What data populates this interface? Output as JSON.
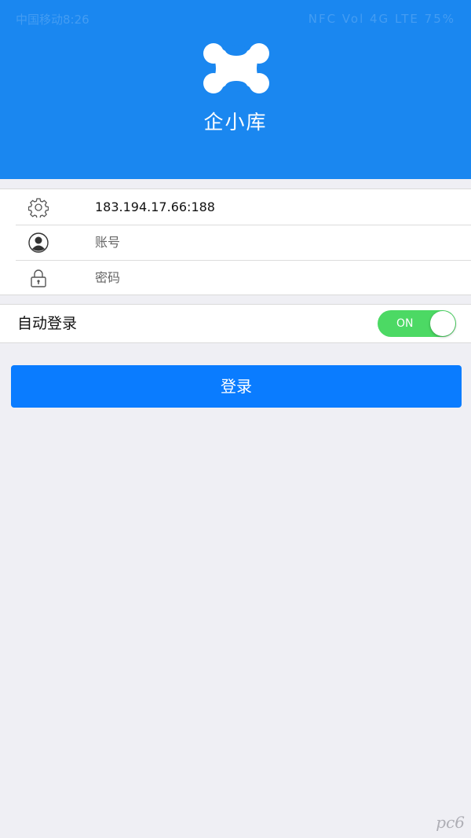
{
  "status_bar": {
    "carrier_time": "中国移动8:26",
    "indicators": "NFC Vol 4G LTE 75%"
  },
  "app": {
    "title": "企小库",
    "logo_icon": "x-logo-icon"
  },
  "form": {
    "server": {
      "icon": "gear-icon",
      "value": "183.194.17.66:188"
    },
    "account": {
      "icon": "user-icon",
      "placeholder": "账号"
    },
    "password": {
      "icon": "lock-icon",
      "placeholder": "密码"
    }
  },
  "auto_login": {
    "label": "自动登录",
    "toggle_text": "ON",
    "enabled": true
  },
  "login_button": {
    "label": "登录"
  },
  "colors": {
    "header": "#1a87f0",
    "button": "#0a7cff",
    "toggle_on": "#4cd964",
    "background": "#efeff4"
  },
  "watermark": "pc6"
}
